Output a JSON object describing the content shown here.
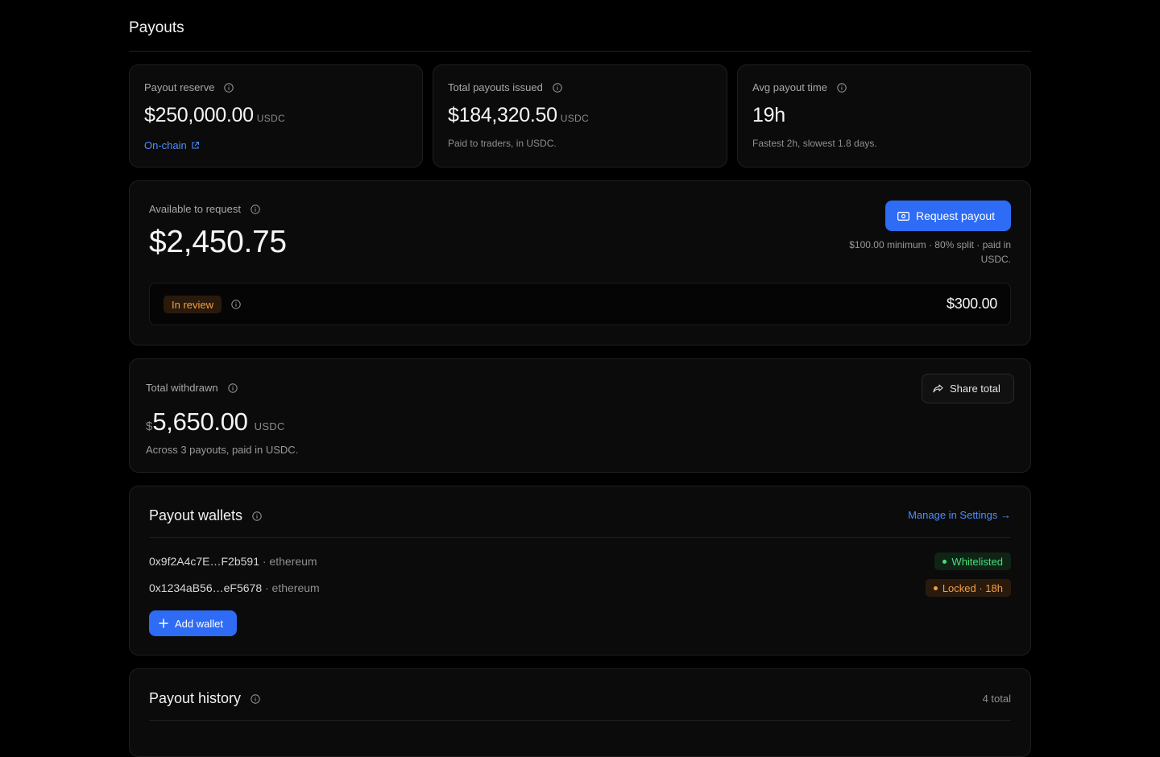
{
  "page": {
    "title": "Payouts"
  },
  "stats": [
    {
      "label": "Payout reserve",
      "value": "$250,000.00",
      "unit": "USDC",
      "link": "On-chain"
    },
    {
      "label": "Total payouts issued",
      "value": "$184,320.50",
      "unit": "USDC",
      "note": "Paid to traders, in USDC."
    },
    {
      "label": "Avg payout time",
      "value": "19h",
      "note": "Fastest 2h, slowest 1.8 days."
    }
  ],
  "available": {
    "label": "Available to request",
    "value": "$2,450.75",
    "button": "Request payout",
    "terms": "$100.00 minimum · 80% split · paid in USDC.",
    "pending": {
      "status": "In review",
      "amount": "$300.00"
    }
  },
  "withdrawn": {
    "label": "Total withdrawn",
    "currency_symbol": "$",
    "value": "5,650.00",
    "unit": "USDC",
    "note": "Across 3 payouts, paid in USDC.",
    "share_button": "Share total"
  },
  "wallets": {
    "title": "Payout wallets",
    "manage_link": "Manage in Settings →",
    "items": [
      {
        "address": "0x9f2A4c7E…F2b591",
        "chain": " · ethereum",
        "status": "Whitelisted",
        "status_color": "#4ade80"
      },
      {
        "address": "0x1234aB56…eF5678",
        "chain": " · ethereum",
        "status": "Locked · 18h",
        "status_color": "#f59e42"
      }
    ],
    "add_button": "Add wallet"
  },
  "history": {
    "title": "Payout history",
    "count": "4 total"
  },
  "icons": {
    "info": "info-icon",
    "external": "external-link-icon",
    "money": "banknote-icon",
    "share": "share-icon",
    "plus": "plus-icon"
  },
  "colors": {
    "accent": "#2e6cf6",
    "link": "#4d8dff",
    "review": "#f59e42",
    "success": "#4ade80"
  }
}
